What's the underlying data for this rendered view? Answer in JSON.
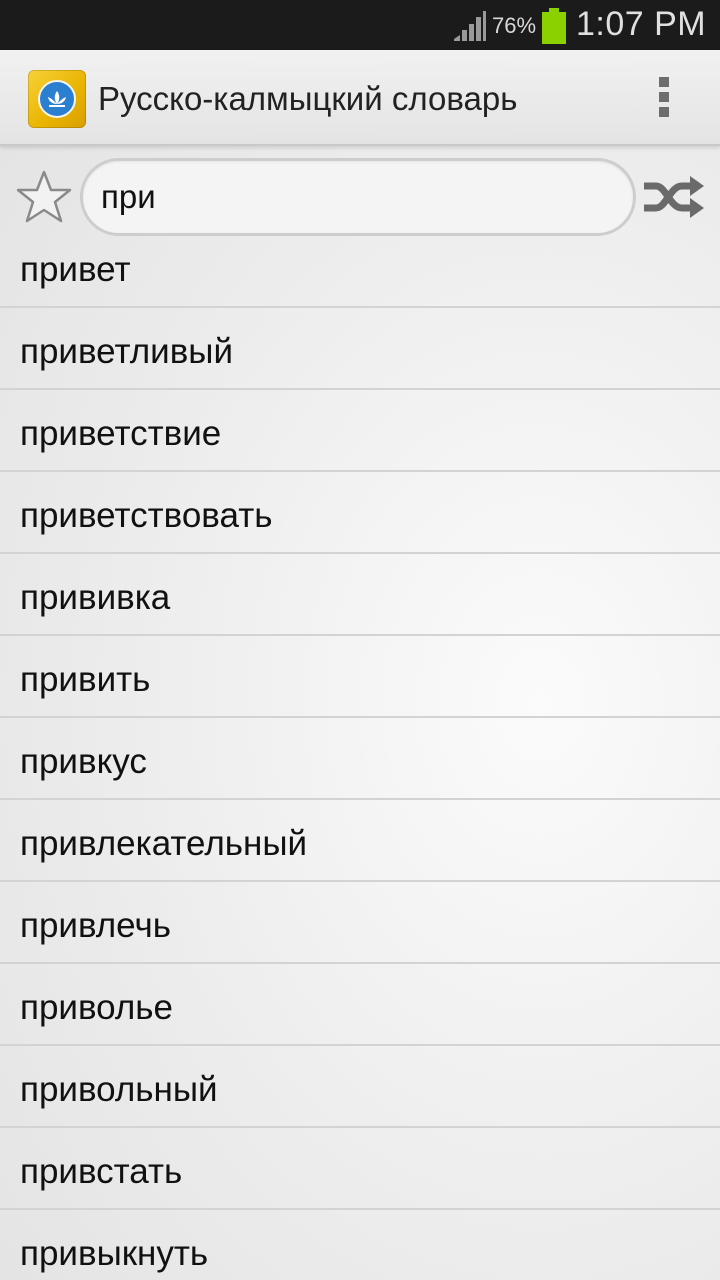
{
  "status_bar": {
    "battery_percent": "76%",
    "time": "1:07 PM",
    "icons": [
      "signal-icon",
      "battery-icon"
    ],
    "battery_color": "#8bd100"
  },
  "app_bar": {
    "title": "Русско-калмыцкий словарь",
    "icons": [
      "app-logo-icon",
      "overflow-menu-icon"
    ]
  },
  "search": {
    "value": "при",
    "placeholder": "",
    "icons": [
      "star-icon",
      "shuffle-icon"
    ]
  },
  "results": [
    "привет",
    "приветливый",
    "приветствие",
    "приветствовать",
    "прививка",
    "привить",
    "привкус",
    "привлекательный",
    "привлечь",
    "приволье",
    "привольный",
    "привстать",
    "привыкнуть"
  ]
}
